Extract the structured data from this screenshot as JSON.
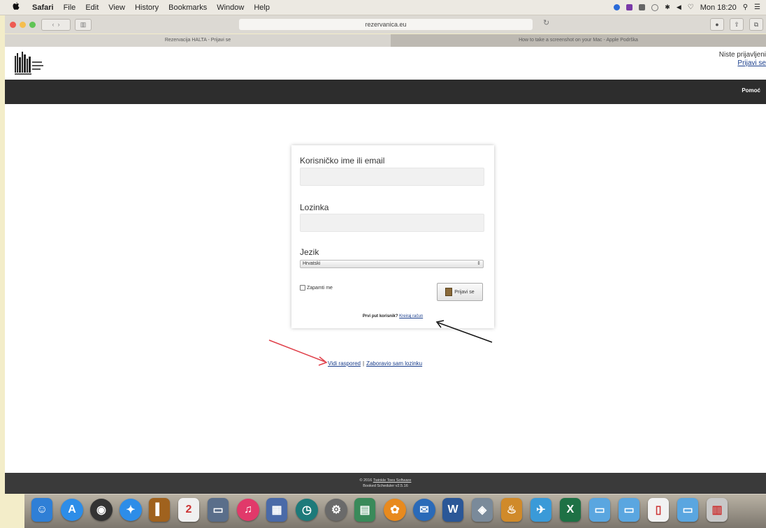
{
  "menubar": {
    "items": [
      "Safari",
      "File",
      "Edit",
      "View",
      "History",
      "Bookmarks",
      "Window",
      "Help"
    ],
    "clock": "Mon 18:20"
  },
  "browser": {
    "url": "rezervanica.eu",
    "tabs": [
      "Rezervacija HALTA - Prijavi se",
      "How to take a screenshot on your Mac - Apple Podrška"
    ]
  },
  "site": {
    "header": {
      "not_logged_in": "Niste prijavljeni",
      "login_link": "Prijavi se"
    },
    "nav": {
      "help": "Pomoć"
    }
  },
  "login": {
    "username_label": "Korisničko ime ili email",
    "password_label": "Lozinka",
    "language_label": "Jezik",
    "language_value": "Hrvatski",
    "remember_me": "Zapamti me",
    "login_button": "Prijavi se",
    "first_time_text": "Prvi put korisnik?",
    "create_account": "Kreiraj račun"
  },
  "links": {
    "view_schedule": "Vidi raspored",
    "separator": "|",
    "forgot_password": "Zaboravio sam lozinku"
  },
  "footer": {
    "copyright": "© 2016",
    "company": "Twinkle Toes Software",
    "version": "Booked Scheduler v2.5.16"
  },
  "colors": {
    "navbar": "#2d2d2d",
    "footer": "#3a3a3a",
    "link": "#1a3e8c",
    "red_arrow": "#e0404a",
    "black_arrow": "#111111"
  },
  "dock": {
    "icons": [
      {
        "name": "finder-icon",
        "glyph": "☺",
        "color": "#2f7fd6"
      },
      {
        "name": "app-store-icon",
        "glyph": "A",
        "color": "#2d8de8"
      },
      {
        "name": "dashboard-icon",
        "glyph": "◉",
        "color": "#333333"
      },
      {
        "name": "safari-icon",
        "glyph": "✦",
        "color": "#2d8de8"
      },
      {
        "name": "notes-book-icon",
        "glyph": "▌",
        "color": "#a0621e"
      },
      {
        "name": "calendar-icon",
        "glyph": "2",
        "color": "#f0f0f0"
      },
      {
        "name": "photos-viewer-icon",
        "glyph": "▭",
        "color": "#5a6e8a"
      },
      {
        "name": "itunes-icon",
        "glyph": "♫",
        "color": "#e1396a"
      },
      {
        "name": "preview-icon",
        "glyph": "▦",
        "color": "#4a6aa8"
      },
      {
        "name": "time-machine-icon",
        "glyph": "◷",
        "color": "#1d7a7a"
      },
      {
        "name": "system-preferences-icon",
        "glyph": "⚙",
        "color": "#6a6a6a"
      },
      {
        "name": "image-capture-icon",
        "glyph": "▤",
        "color": "#3a8a5a"
      },
      {
        "name": "photos-icon",
        "glyph": "✿",
        "color": "#e88a1e"
      },
      {
        "name": "thunderbird-icon",
        "glyph": "✉",
        "color": "#2a6ab8"
      },
      {
        "name": "word-icon",
        "glyph": "W",
        "color": "#2b5797"
      },
      {
        "name": "network-icon",
        "glyph": "◈",
        "color": "#7a8a9a"
      },
      {
        "name": "maple-syrup-icon",
        "glyph": "♨",
        "color": "#d08a2a"
      },
      {
        "name": "migration-icon",
        "glyph": "✈",
        "color": "#3a9ad8"
      },
      {
        "name": "excel-icon",
        "glyph": "X",
        "color": "#1e7145"
      },
      {
        "name": "folder-icon",
        "glyph": "▭",
        "color": "#5aa6e0"
      },
      {
        "name": "folder-documents-icon",
        "glyph": "▭",
        "color": "#5aa6e0"
      },
      {
        "name": "file-icon",
        "glyph": "▯",
        "color": "#f2f2f2"
      },
      {
        "name": "folder-downloads-icon",
        "glyph": "▭",
        "color": "#5aa6e0"
      },
      {
        "name": "trash-icon",
        "glyph": "▥",
        "color": "#c8c8c8"
      }
    ]
  }
}
